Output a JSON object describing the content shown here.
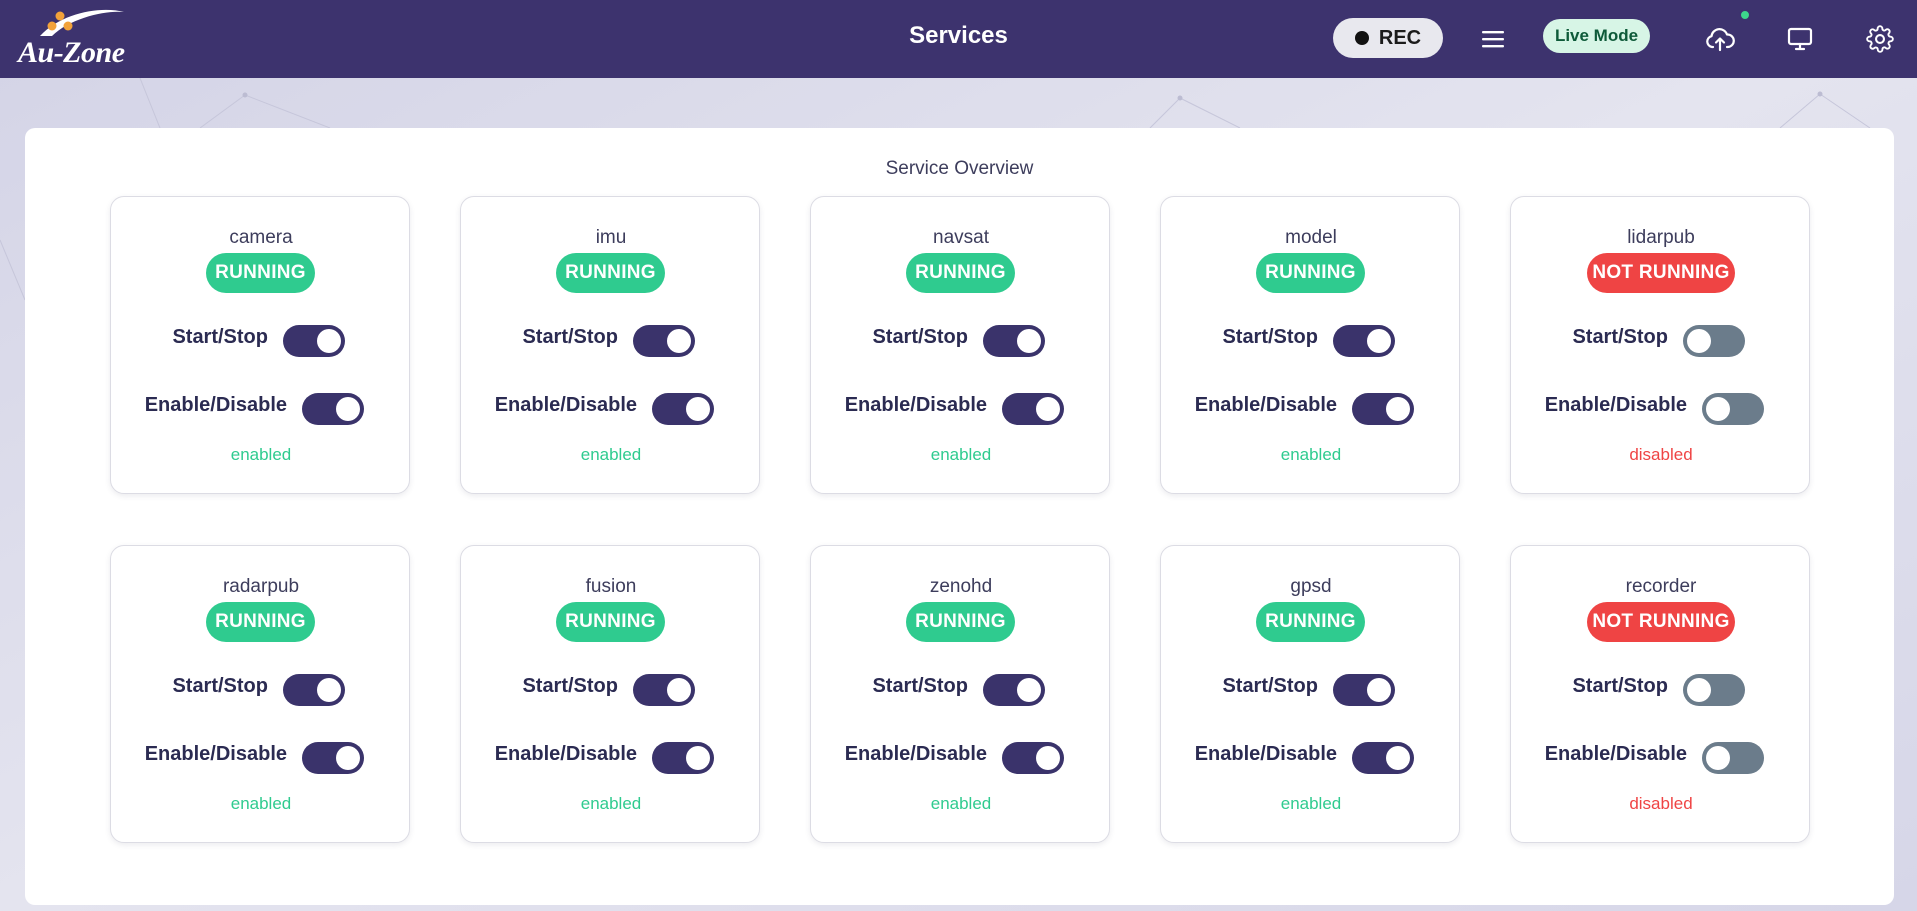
{
  "header": {
    "logo_text": "Au-Zone",
    "title": "Services",
    "rec_label": "REC",
    "live_mode_label": "Live Mode"
  },
  "panel": {
    "title": "Service Overview",
    "start_stop_label": "Start/Stop",
    "enable_disable_label": "Enable/Disable"
  },
  "colors": {
    "header_bg": "#3d336e",
    "running": "#2fcb8f",
    "not_running": "#ef4444",
    "toggle_on": "#3a336b",
    "toggle_off": "#6b7c8b"
  },
  "services": [
    {
      "name": "camera",
      "status": "RUNNING",
      "running": true,
      "started": true,
      "enabled": true,
      "state": "enabled"
    },
    {
      "name": "imu",
      "status": "RUNNING",
      "running": true,
      "started": true,
      "enabled": true,
      "state": "enabled"
    },
    {
      "name": "navsat",
      "status": "RUNNING",
      "running": true,
      "started": true,
      "enabled": true,
      "state": "enabled"
    },
    {
      "name": "model",
      "status": "RUNNING",
      "running": true,
      "started": true,
      "enabled": true,
      "state": "enabled"
    },
    {
      "name": "lidarpub",
      "status": "NOT RUNNING",
      "running": false,
      "started": false,
      "enabled": false,
      "state": "disabled"
    },
    {
      "name": "radarpub",
      "status": "RUNNING",
      "running": true,
      "started": true,
      "enabled": true,
      "state": "enabled"
    },
    {
      "name": "fusion",
      "status": "RUNNING",
      "running": true,
      "started": true,
      "enabled": true,
      "state": "enabled"
    },
    {
      "name": "zenohd",
      "status": "RUNNING",
      "running": true,
      "started": true,
      "enabled": true,
      "state": "enabled"
    },
    {
      "name": "gpsd",
      "status": "RUNNING",
      "running": true,
      "started": true,
      "enabled": true,
      "state": "enabled"
    },
    {
      "name": "recorder",
      "status": "NOT RUNNING",
      "running": false,
      "started": false,
      "enabled": false,
      "state": "disabled"
    }
  ]
}
